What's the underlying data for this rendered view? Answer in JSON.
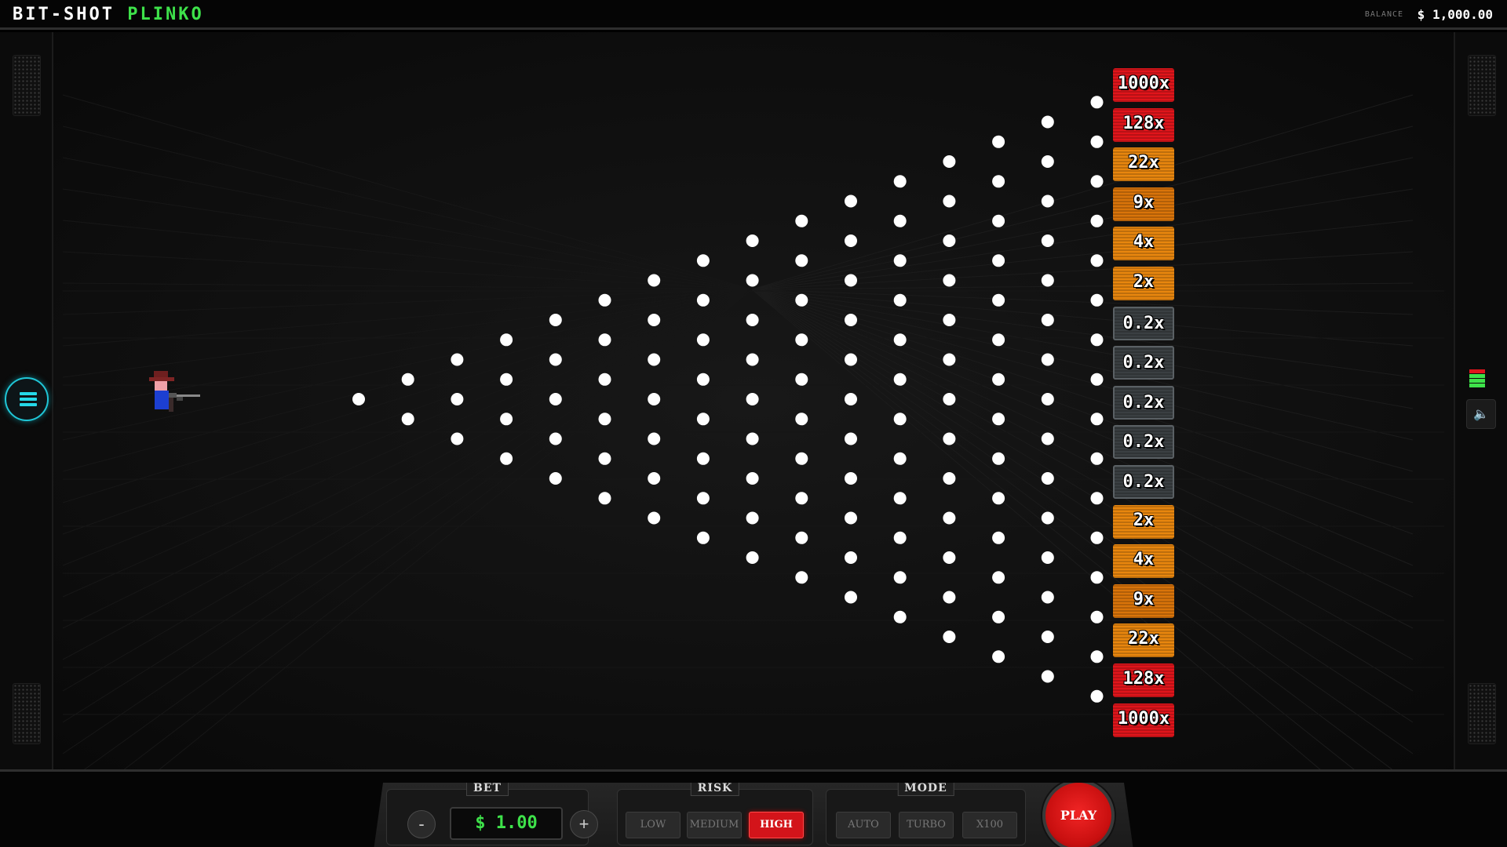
{
  "header": {
    "title_main": "BIT-SHOT ",
    "title_accent": "PLINKO",
    "balance_label": "BALANCE",
    "balance_value": "$ 1,000.00"
  },
  "board": {
    "rows": 16,
    "buckets": [
      {
        "label": "1000x",
        "color": "#e0151b"
      },
      {
        "label": "128x",
        "color": "#e0151b"
      },
      {
        "label": "22x",
        "color": "#e8860e"
      },
      {
        "label": "9x",
        "color": "#d9740a"
      },
      {
        "label": "4x",
        "color": "#e8860e"
      },
      {
        "label": "2x",
        "color": "#e8860e"
      },
      {
        "label": "0.2x",
        "color": "#3a3f42"
      },
      {
        "label": "0.2x",
        "color": "#3a3f42"
      },
      {
        "label": "0.2x",
        "color": "#3a3f42"
      },
      {
        "label": "0.2x",
        "color": "#3a3f42"
      },
      {
        "label": "0.2x",
        "color": "#3a3f42"
      },
      {
        "label": "2x",
        "color": "#e8860e"
      },
      {
        "label": "4x",
        "color": "#e8860e"
      },
      {
        "label": "9x",
        "color": "#d9740a"
      },
      {
        "label": "22x",
        "color": "#e8860e"
      },
      {
        "label": "128x",
        "color": "#e0151b"
      },
      {
        "label": "1000x",
        "color": "#e0151b"
      }
    ]
  },
  "controls": {
    "bet": {
      "label": "BET",
      "value": "$ 1.00",
      "decrease": "-",
      "increase": "+"
    },
    "risk": {
      "label": "RISK",
      "options": [
        "LOW",
        "MEDIUM",
        "HIGH"
      ],
      "selected": "HIGH"
    },
    "mode": {
      "label": "MODE",
      "options": [
        "AUTO",
        "TURBO",
        "X100"
      ]
    },
    "play_label": "PLAY"
  },
  "icons": {
    "menu": "hamburger-icon",
    "sound": "speaker-icon",
    "level": "level-bars-icon"
  },
  "colors": {
    "accent_green": "#3ee24a",
    "accent_cyan": "#25d8e8",
    "active_red": "#d3141a"
  }
}
